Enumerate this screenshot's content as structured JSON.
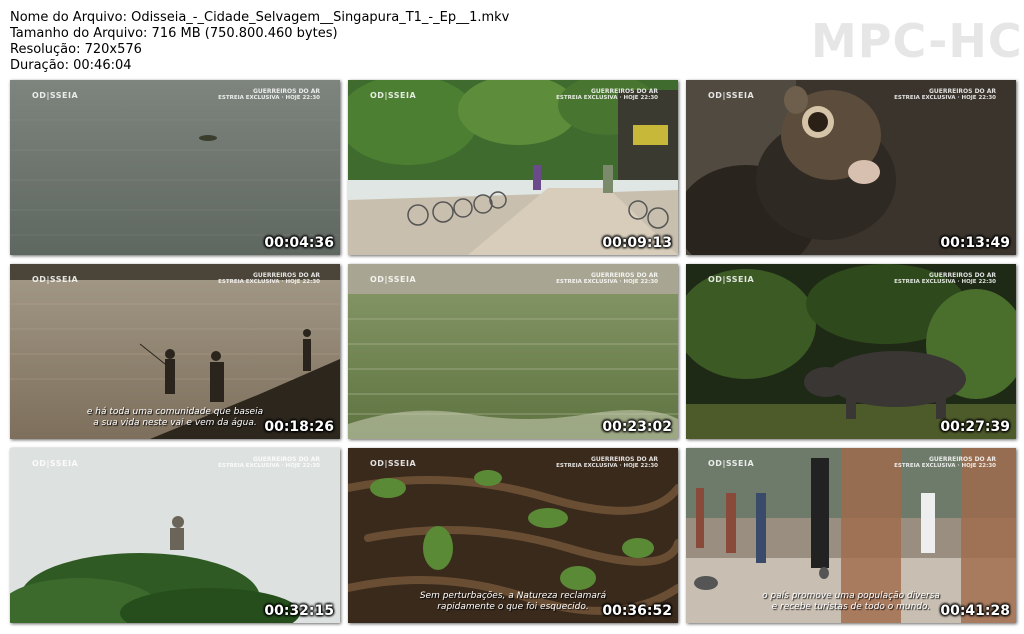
{
  "file_info": {
    "name": "Nome do Arquivo: Odisseia_-_Cidade_Selvagem__Singapura_T1_-_Ep__1.mkv",
    "size": "Tamanho do Arquivo: 716 MB (750.800.460 bytes)",
    "resolution": "Resolução: 720x576",
    "duration": "Duração: 00:46:04"
  },
  "logo": "MPC-HC",
  "watermark": "OD|SSEIA",
  "promo": {
    "line1": "GUERREIROS DO AR",
    "line2": "ESTREIA EXCLUSIVA · HOJE 22:30"
  },
  "thumbnails": [
    {
      "timestamp": "00:04:36",
      "subtitle": []
    },
    {
      "timestamp": "00:09:13",
      "subtitle": []
    },
    {
      "timestamp": "00:13:49",
      "subtitle": []
    },
    {
      "timestamp": "00:18:26",
      "subtitle": [
        "e há toda uma comunidade que baseia",
        "a sua vida neste vai e vem da água."
      ]
    },
    {
      "timestamp": "00:23:02",
      "subtitle": []
    },
    {
      "timestamp": "00:27:39",
      "subtitle": []
    },
    {
      "timestamp": "00:32:15",
      "subtitle": []
    },
    {
      "timestamp": "00:36:52",
      "subtitle": [
        "Sem perturbações, a Natureza reclamará",
        "rapidamente o que foi esquecido."
      ]
    },
    {
      "timestamp": "00:41:28",
      "subtitle": [
        "o país promove uma população diversa",
        "e recebe turistas de todo o mundo."
      ]
    }
  ]
}
